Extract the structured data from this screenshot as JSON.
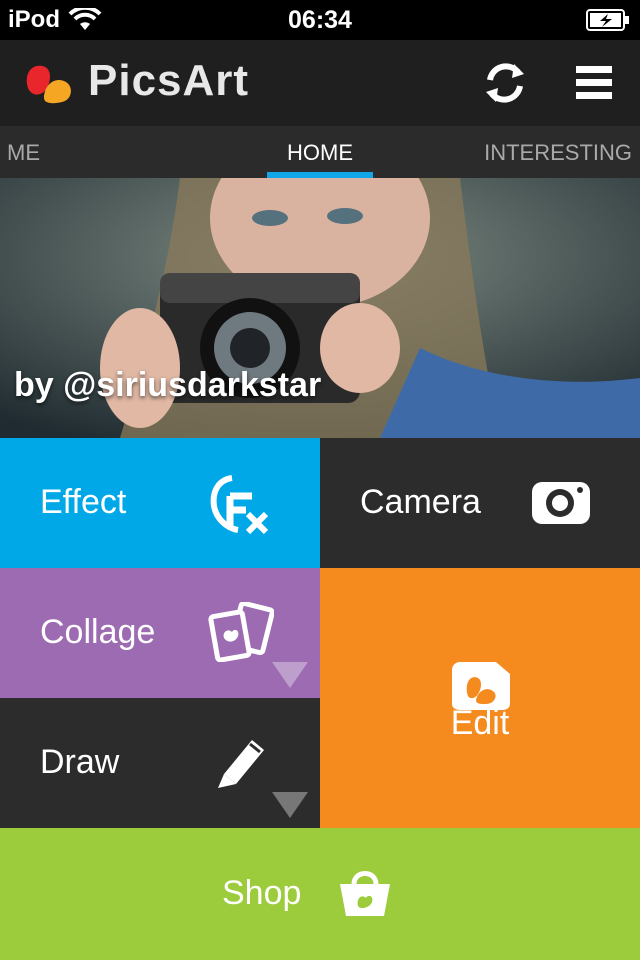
{
  "status_bar": {
    "carrier": "iPod",
    "time": "06:34"
  },
  "app_bar": {
    "logo_text": "PicsArt"
  },
  "tabs": [
    {
      "label": "ME"
    },
    {
      "label": "HOME",
      "active": true
    },
    {
      "label": "INTERESTING"
    }
  ],
  "hero": {
    "credit": "by @siriusdarkstar"
  },
  "tiles": {
    "effect": {
      "label": "Effect",
      "color": "#00a8e8",
      "icon": "fx-icon"
    },
    "camera": {
      "label": "Camera",
      "color": "#2c2c2c",
      "icon": "camera-icon"
    },
    "collage": {
      "label": "Collage",
      "color": "#9c6bb2",
      "icon": "collage-icon"
    },
    "edit": {
      "label": "Edit",
      "color": "#f58b1f",
      "icon": "picsart-edit-icon"
    },
    "draw": {
      "label": "Draw",
      "color": "#2c2c2c",
      "icon": "pencil-icon"
    },
    "shop": {
      "label": "Shop",
      "color": "#9ccb3b",
      "icon": "shopping-bag-icon"
    }
  },
  "colors": {
    "accent": "#12a6e8"
  }
}
